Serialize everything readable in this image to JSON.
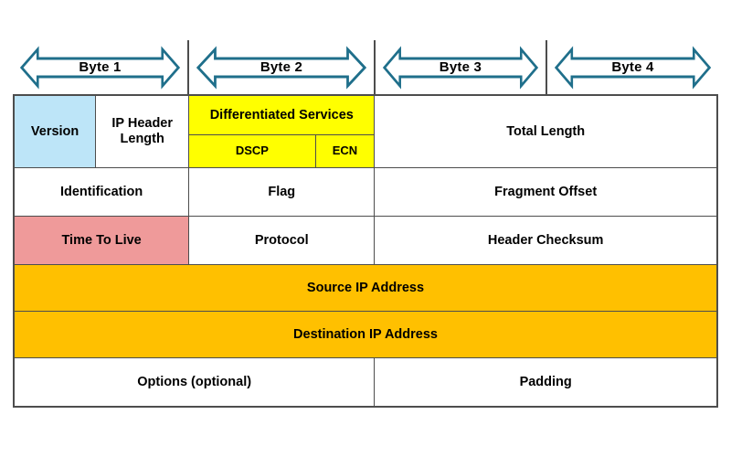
{
  "colors": {
    "version": "#bde5f8",
    "diffserv": "#ffff00",
    "ttl": "#ef9a9a",
    "address": "#ffc000",
    "arrow_stroke": "#1f6f8b",
    "border": "#4d4d4d",
    "background": "#ffffff"
  },
  "byte_ruler": {
    "bytes": [
      {
        "label": "Byte 1",
        "width_pct": 24.74
      },
      {
        "label": "Byte 2",
        "width_pct": 26.42
      },
      {
        "label": "Byte 3",
        "width_pct": 24.35
      },
      {
        "label": "Byte 4",
        "width_pct": 24.49
      }
    ]
  },
  "header_rows": [
    {
      "name": "row-1",
      "fields": [
        {
          "label": "Version",
          "color": "version",
          "width_pct": 11.53
        },
        {
          "label": "IP Header Length",
          "color": "none",
          "width_pct": 13.21
        },
        {
          "label": "Differentiated Services",
          "color": "diffserv",
          "width_pct": 26.42,
          "subfields": [
            {
              "label": "DSCP"
            },
            {
              "label": "ECN"
            }
          ]
        },
        {
          "label": "Total Length",
          "color": "none",
          "width_pct": 48.84
        }
      ]
    },
    {
      "name": "row-2",
      "fields": [
        {
          "label": "Identification",
          "color": "none",
          "width_pct": 51.16
        },
        {
          "label": "Flag",
          "color": "none",
          "width_pct": 12.18
        },
        {
          "label": "Fragment Offset",
          "color": "none",
          "width_pct": 36.66
        }
      ]
    },
    {
      "name": "row-3",
      "fields": [
        {
          "label": "Time To Live",
          "color": "ttl",
          "width_pct": 24.74
        },
        {
          "label": "Protocol",
          "color": "none",
          "width_pct": 26.42
        },
        {
          "label": "Header Checksum",
          "color": "none",
          "width_pct": 48.84
        }
      ]
    },
    {
      "name": "row-4",
      "fields": [
        {
          "label": "Source IP Address",
          "color": "address",
          "width_pct": 100
        }
      ]
    },
    {
      "name": "row-5",
      "fields": [
        {
          "label": "Destination IP Address",
          "color": "address",
          "width_pct": 100
        }
      ]
    },
    {
      "name": "row-6",
      "fields": [
        {
          "label": "Options (optional)",
          "color": "none",
          "width_pct": 80.83
        },
        {
          "label": "Padding",
          "color": "none",
          "width_pct": 19.17
        }
      ]
    }
  ]
}
